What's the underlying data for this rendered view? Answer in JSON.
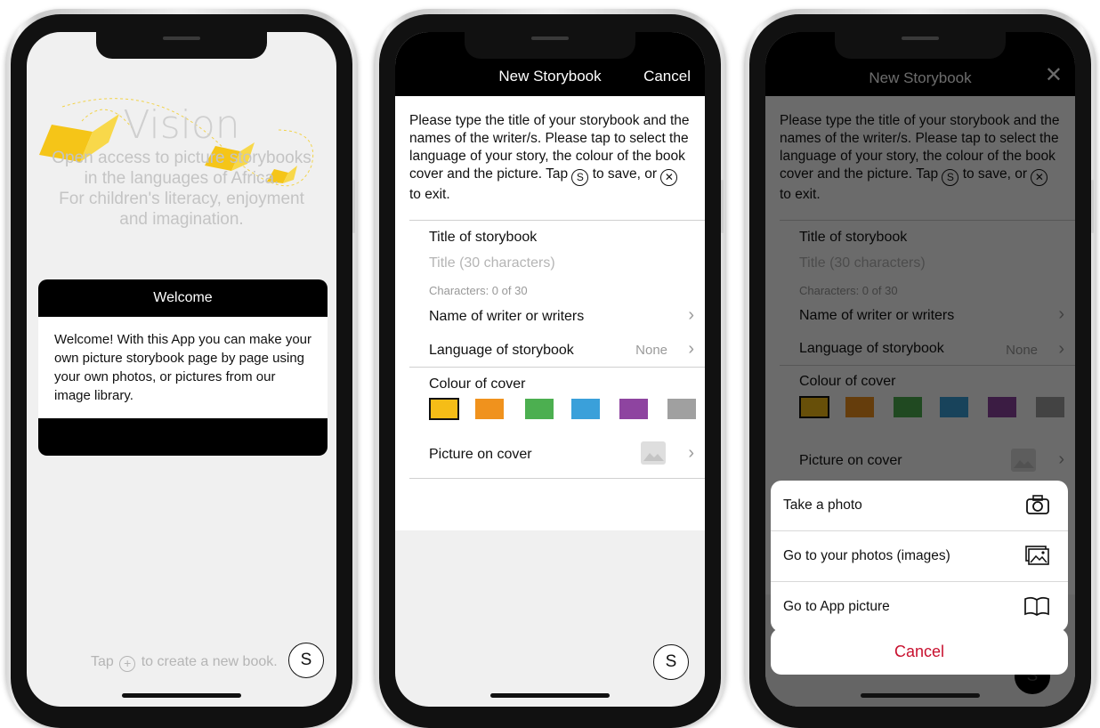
{
  "phone1": {
    "vision": {
      "title": "Vision",
      "lines": [
        "Open access to picture storybooks",
        "in the languages of Africa.",
        "For children's literacy, enjoyment",
        "and imagination."
      ]
    },
    "welcome": {
      "title": "Welcome",
      "body": "Welcome! With this App you can make your own picture storybook page by page using your own photos, or pictures from our image library."
    },
    "tap_hint": {
      "before": "Tap",
      "plus_icon": "plus-circle-icon",
      "after": "to create a new book."
    },
    "save_label": "S"
  },
  "form": {
    "nav_title": "New Storybook",
    "cancel": "Cancel",
    "close_icon": "✕",
    "intro": {
      "part1": "Please type the title of your storybook and the names of the writer/s. Please tap to select the language of your story, the colour of the book cover and the picture. Tap",
      "save_symbol": "S",
      "part2": "to save, or",
      "exit_symbol": "✕",
      "part3": "to exit."
    },
    "title_label": "Title of storybook",
    "title_placeholder": "Title (30 characters)",
    "char_count": "Characters: 0 of 30",
    "writers_label": "Name of writer or writers",
    "language_label": "Language of storybook",
    "language_value": "None",
    "colour_label": "Colour of cover",
    "colours": [
      "#f5bd17",
      "#f0921d",
      "#4caf50",
      "#3aa0da",
      "#8e44a0",
      "#a0a0a0"
    ],
    "picture_label": "Picture on cover",
    "chevron": "›",
    "save_label": "S"
  },
  "sheet": {
    "options": [
      {
        "label": "Take a photo",
        "icon": "camera-icon"
      },
      {
        "label": "Go to your photos (images)",
        "icon": "image-icon"
      },
      {
        "label": "Go to App picture",
        "icon": "book-icon"
      }
    ],
    "cancel": "Cancel"
  }
}
